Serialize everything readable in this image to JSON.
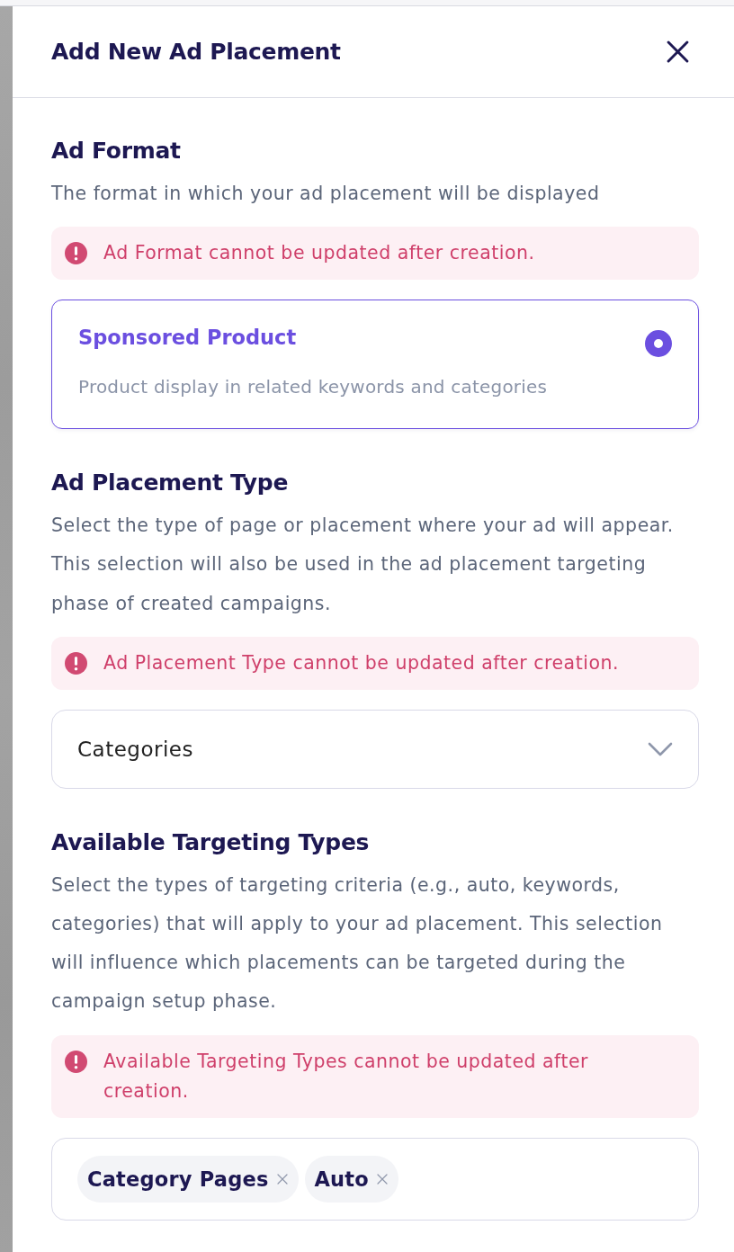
{
  "drawer": {
    "title": "Add New Ad Placement"
  },
  "sections": [
    {
      "kind": "format",
      "heading": "Ad Format",
      "description": "The format in which your ad placement will be displayed",
      "alert": "Ad Format cannot be updated after creation.",
      "options": [
        {
          "title": "Sponsored Product",
          "description": "Product display in related keywords and categories",
          "selected": true
        }
      ]
    },
    {
      "kind": "select",
      "heading": "Ad Placement Type",
      "description": "Select the type of page or placement where your ad will appear. This selection will also be used in the ad placement targeting phase of created campaigns.",
      "alert": "Ad Placement Type cannot be updated after creation.",
      "select": {
        "value": "Categories"
      }
    },
    {
      "kind": "tags",
      "heading": "Available Targeting Types",
      "description": "Select the types of targeting criteria (e.g., auto, keywords, categories) that will apply to your ad placement. This selection will influence which placements can be targeted during the campaign setup phase.",
      "alert": "Available Targeting Types cannot be updated after creation.",
      "tags": [
        "Category Pages",
        "Auto"
      ]
    }
  ]
}
